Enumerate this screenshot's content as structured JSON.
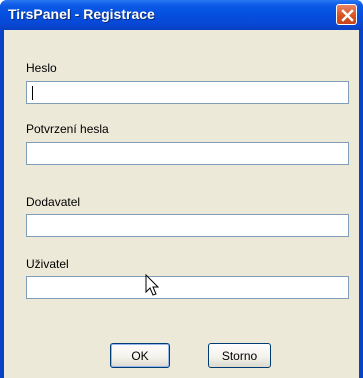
{
  "window": {
    "title": "TirsPanel - Registrace"
  },
  "form": {
    "heslo_label": "Heslo",
    "heslo_value": "",
    "potvrzeni_label": "Potvrzení hesla",
    "potvrzeni_value": "",
    "dodavatel_label": "Dodavatel",
    "dodavatel_value": "",
    "uzivatel_label": "Uživatel",
    "uzivatel_value": ""
  },
  "buttons": {
    "ok_label": "OK",
    "storno_label": "Storno"
  },
  "icons": {
    "close": "close-icon",
    "cursor": "mouse-pointer-icon"
  },
  "colors": {
    "titlebar": "#0450e0",
    "close_button": "#d9531f",
    "dialog_face": "#ece9d8",
    "field_border": "#7f9db9"
  }
}
